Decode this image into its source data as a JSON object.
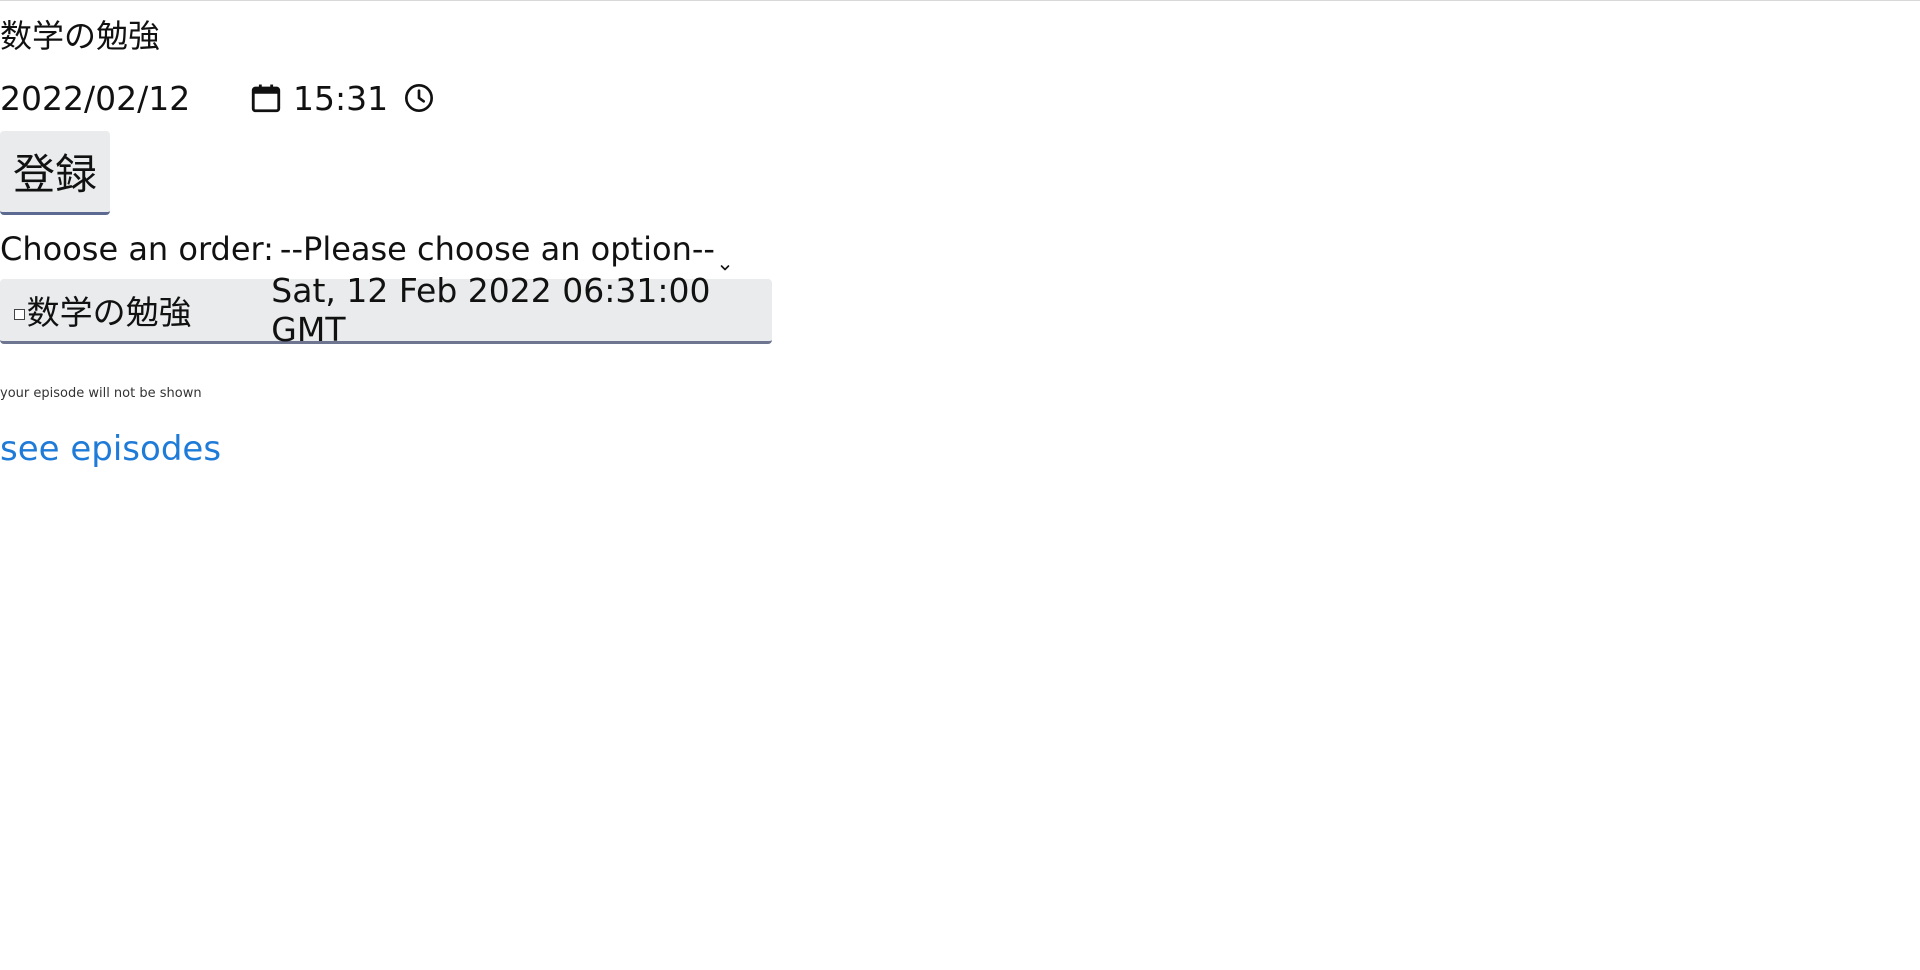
{
  "task": {
    "title_value": "数学の勉強"
  },
  "datetime": {
    "date": "2022/02/12",
    "time": "15:31",
    "calendar_icon": "calendar-icon",
    "clock_icon": "clock-icon"
  },
  "register_button": {
    "label": "登録"
  },
  "order": {
    "label": "Choose an order:",
    "selected": "--Please choose an option--"
  },
  "episodes": [
    {
      "name": "数学の勉強",
      "date": "Sat, 12 Feb 2022 06:31:00 GMT",
      "checked": false
    }
  ],
  "note": "your episode will not be shown",
  "link": {
    "label": "see episodes"
  },
  "colors": {
    "link": "#1e7bd8",
    "button_bg": "#e9ebec",
    "button_border": "#5c6a91"
  }
}
